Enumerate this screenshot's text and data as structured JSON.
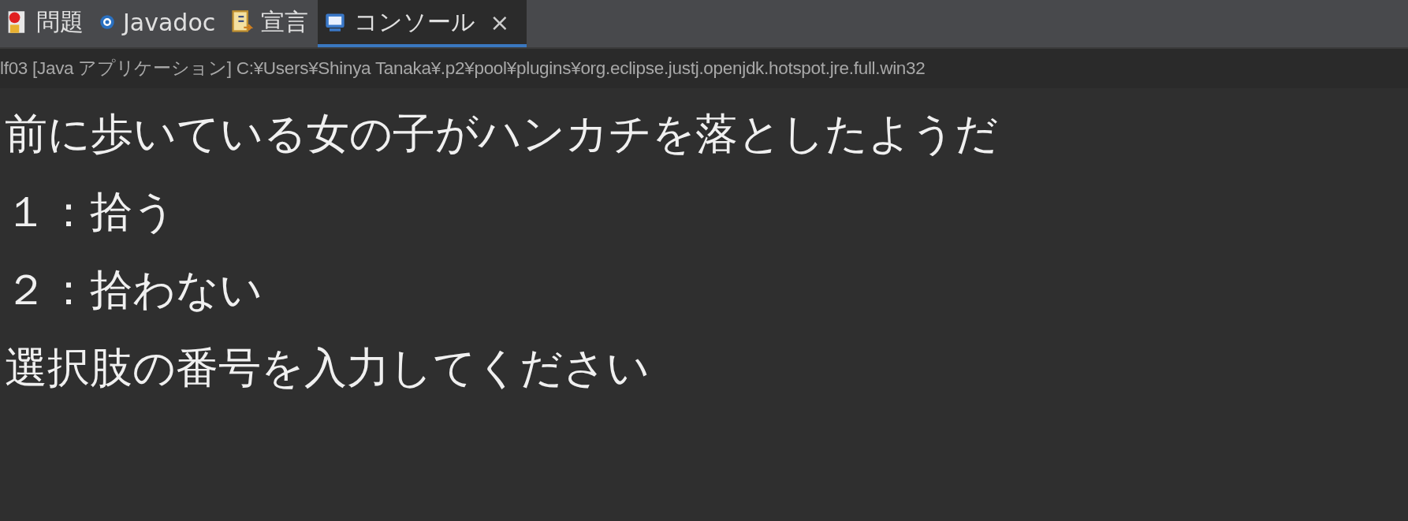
{
  "tabs": [
    {
      "label": "問題",
      "kind": "problems",
      "selected": false
    },
    {
      "label": "Javadoc",
      "kind": "javadoc",
      "selected": false
    },
    {
      "label": "宣言",
      "kind": "declaration",
      "selected": false
    },
    {
      "label": "コンソール",
      "kind": "console",
      "selected": true,
      "close": "×"
    }
  ],
  "launch_info": "lf03 [Java アプリケーション] C:¥Users¥Shinya Tanaka¥.p2¥pool¥plugins¥org.eclipse.justj.openjdk.hotspot.jre.full.win32",
  "console_lines": [
    "前に歩いている女の子がハンカチを落としたようだ",
    "１：拾う",
    "２：拾わない",
    "選択肢の番号を入力してください"
  ]
}
